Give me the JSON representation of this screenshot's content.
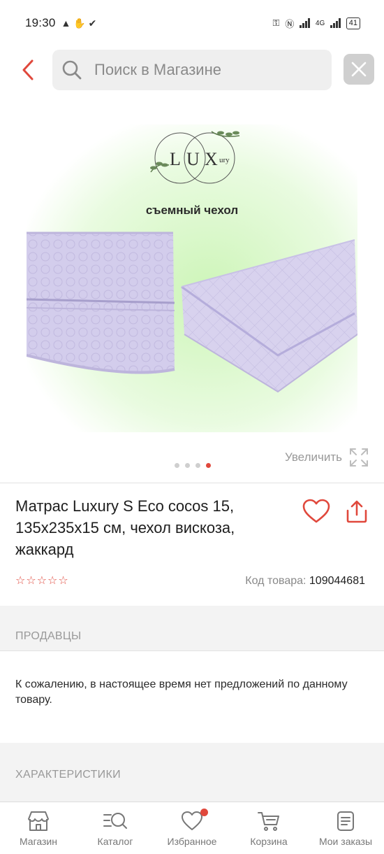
{
  "status_bar": {
    "time": "19:30",
    "network": "4G",
    "battery": "41"
  },
  "search": {
    "placeholder": "Поиск в Магазине"
  },
  "gallery": {
    "image_caption": "съемный чехол",
    "logo_letters": "LUXury",
    "zoom_label": "Увеличить",
    "page_count": 4,
    "active_page": 4
  },
  "product": {
    "title": "Матрас Luxury S Eco cocos 15, 135x235x15 см, чехол вискоза, жаккард",
    "rating_stars": 0,
    "sku_label": "Код товара:",
    "sku_value": "109044681"
  },
  "sections": {
    "sellers_title": "ПРОДАВЦЫ",
    "sellers_message": "К сожалению, в настоящее время нет предложений по данному товару.",
    "specs_title": "ХАРАКТЕРИСТИКИ"
  },
  "bottom_nav": [
    {
      "label": "Магазин",
      "icon": "store-icon"
    },
    {
      "label": "Каталог",
      "icon": "catalog-search-icon"
    },
    {
      "label": "Избранное",
      "icon": "heart-icon"
    },
    {
      "label": "Корзина",
      "icon": "cart-icon"
    },
    {
      "label": "Мои заказы",
      "icon": "orders-icon"
    }
  ],
  "colors": {
    "accent": "#e0483c",
    "muted": "#999999",
    "band": "#f3f3f3"
  }
}
